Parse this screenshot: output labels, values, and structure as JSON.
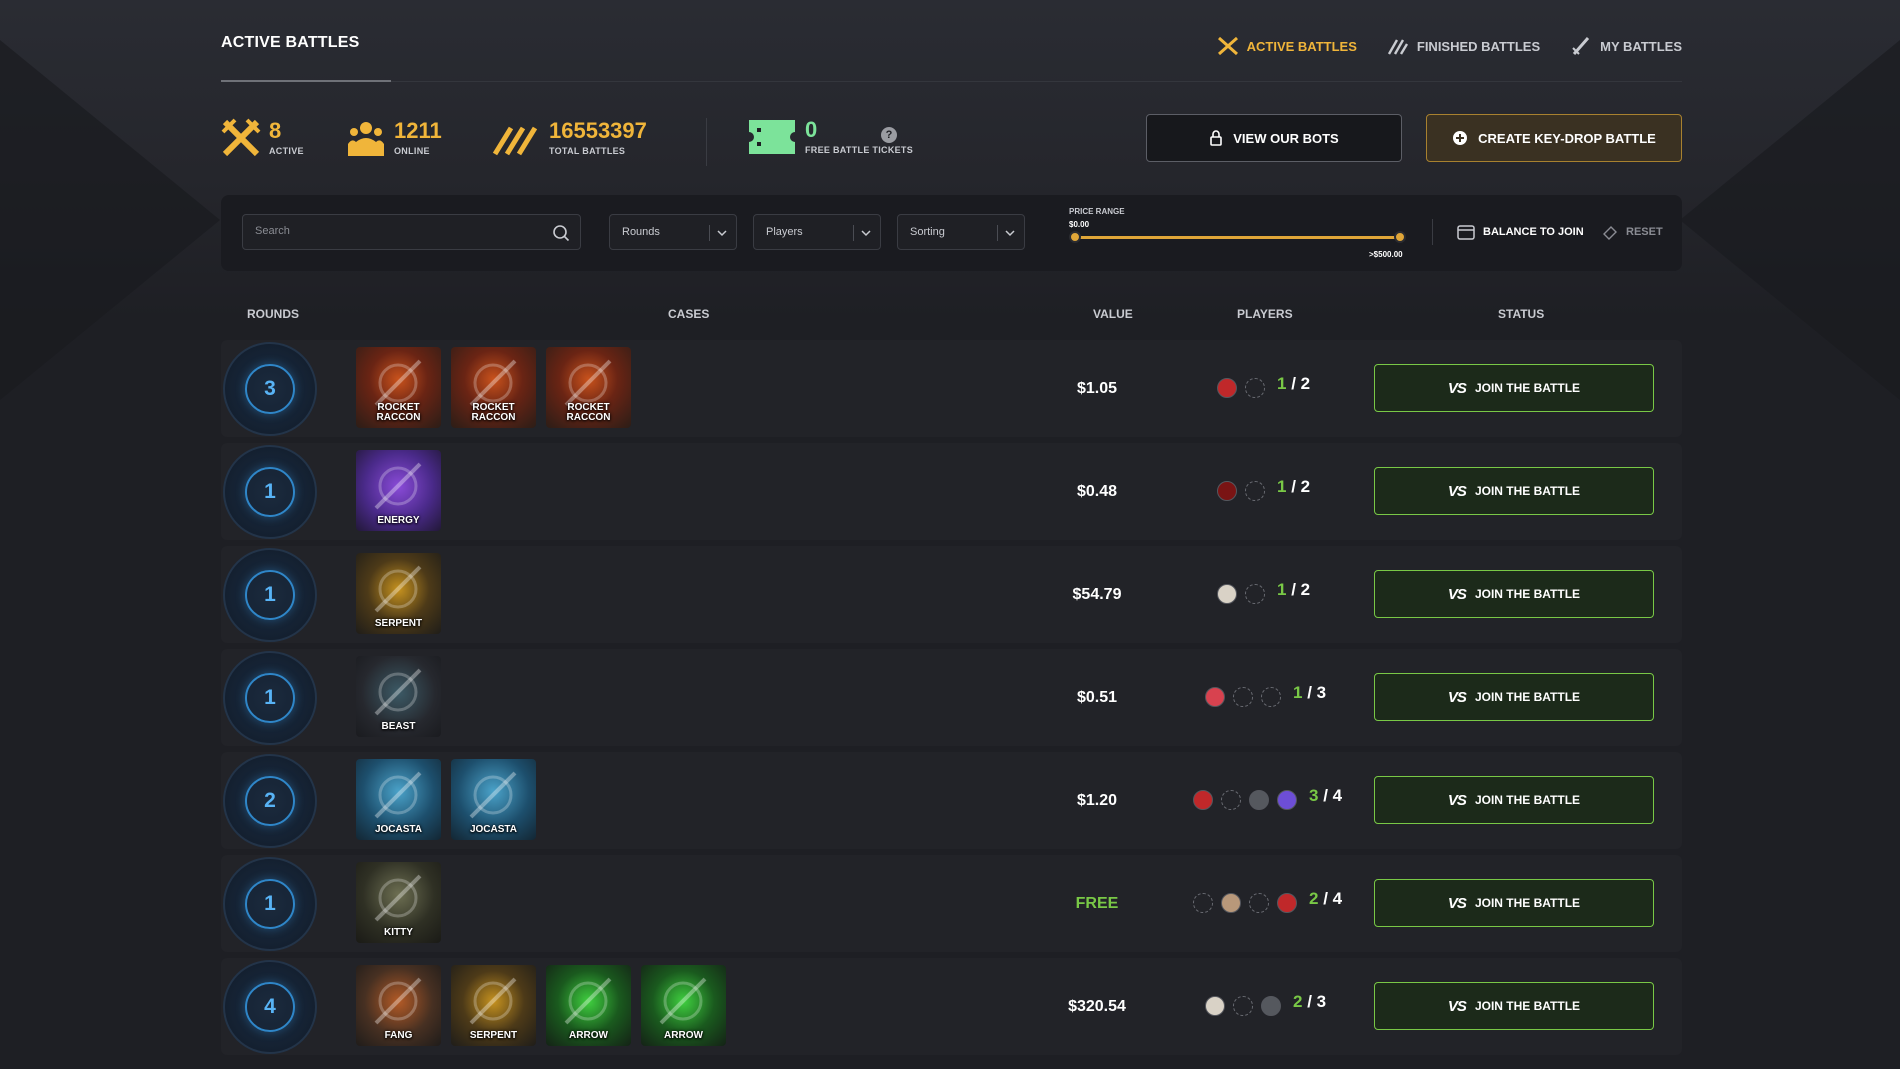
{
  "header": {
    "title": "ACTIVE BATTLES",
    "nav": [
      {
        "label": "ACTIVE BATTLES",
        "icon": "swords-icon",
        "active": true
      },
      {
        "label": "FINISHED BATTLES",
        "icon": "finished-swords-icon",
        "active": false
      },
      {
        "label": "MY BATTLES",
        "icon": "sword-icon",
        "active": false
      }
    ]
  },
  "stats": {
    "active": {
      "value": "8",
      "label": "ACTIVE"
    },
    "online": {
      "value": "1211",
      "label": "ONLINE"
    },
    "total": {
      "value": "16553397",
      "label": "TOTAL BATTLES"
    },
    "tickets": {
      "value": "0",
      "label": "FREE BATTLE TICKETS"
    },
    "help": "?"
  },
  "actions": {
    "bots_label": "VIEW OUR BOTS",
    "create_label": "CREATE KEY-DROP BATTLE"
  },
  "filters": {
    "search_placeholder": "Search",
    "rounds": "Rounds",
    "players": "Players",
    "sorting": "Sorting",
    "price_label": "PRICE RANGE",
    "price_min": "$0.00",
    "price_max": ">$500.00",
    "price_min_fraction": 0.0,
    "price_max_fraction": 1.0,
    "balance_label": "BALANCE TO JOIN",
    "reset_label": "RESET"
  },
  "table": {
    "headers": {
      "rounds": "ROUNDS",
      "cases": "CASES",
      "value": "VALUE",
      "players": "PLAYERS",
      "status": "STATUS"
    },
    "join_label": "JOIN THE BATTLE",
    "vs_label": "VS",
    "rows": [
      {
        "rounds": "3",
        "cases": [
          "ROCKET\nRACCON",
          "ROCKET\nRACCON",
          "ROCKET\nRACCON"
        ],
        "case_types": [
          "rocket",
          "rocket",
          "rocket"
        ],
        "value": "$1.05",
        "free": false,
        "players": [
          "red",
          "empty"
        ],
        "current": "1",
        "max": "/ 2"
      },
      {
        "rounds": "1",
        "cases": [
          "ENERGY"
        ],
        "case_types": [
          "energy"
        ],
        "value": "$0.48",
        "free": false,
        "players": [
          "darkred",
          "empty"
        ],
        "current": "1",
        "max": "/ 2"
      },
      {
        "rounds": "1",
        "cases": [
          "SERPENT"
        ],
        "case_types": [
          "serpent"
        ],
        "value": "$54.79",
        "free": false,
        "players": [
          "beige",
          "empty"
        ],
        "current": "1",
        "max": "/ 2"
      },
      {
        "rounds": "1",
        "cases": [
          "BEAST"
        ],
        "case_types": [
          "beast"
        ],
        "value": "$0.51",
        "free": false,
        "players": [
          "pink",
          "empty",
          "empty"
        ],
        "current": "1",
        "max": "/ 3"
      },
      {
        "rounds": "2",
        "cases": [
          "JOCASTA",
          "JOCASTA"
        ],
        "case_types": [
          "jocasta",
          "jocasta"
        ],
        "value": "$1.20",
        "free": false,
        "players": [
          "red",
          "empty",
          "grey",
          "purple"
        ],
        "current": "3",
        "max": "/ 4"
      },
      {
        "rounds": "1",
        "cases": [
          "KITTY"
        ],
        "case_types": [
          "kitty"
        ],
        "value": "FREE",
        "free": true,
        "players": [
          "empty",
          "tan",
          "empty",
          "red"
        ],
        "current": "2",
        "max": "/ 4"
      },
      {
        "rounds": "4",
        "cases": [
          "FANG",
          "SERPENT",
          "ARROW",
          "ARROW"
        ],
        "case_types": [
          "fang",
          "serpent",
          "arrow",
          "arrow"
        ],
        "value": "$320.54",
        "free": false,
        "players": [
          "beige",
          "empty",
          "grey"
        ],
        "current": "2",
        "max": "/ 3"
      }
    ]
  },
  "colors": {
    "accent": "#f0b53a",
    "join_border": "#79c846",
    "rounds_blue": "#58b3f5",
    "tickets_green": "#7ce39a"
  }
}
